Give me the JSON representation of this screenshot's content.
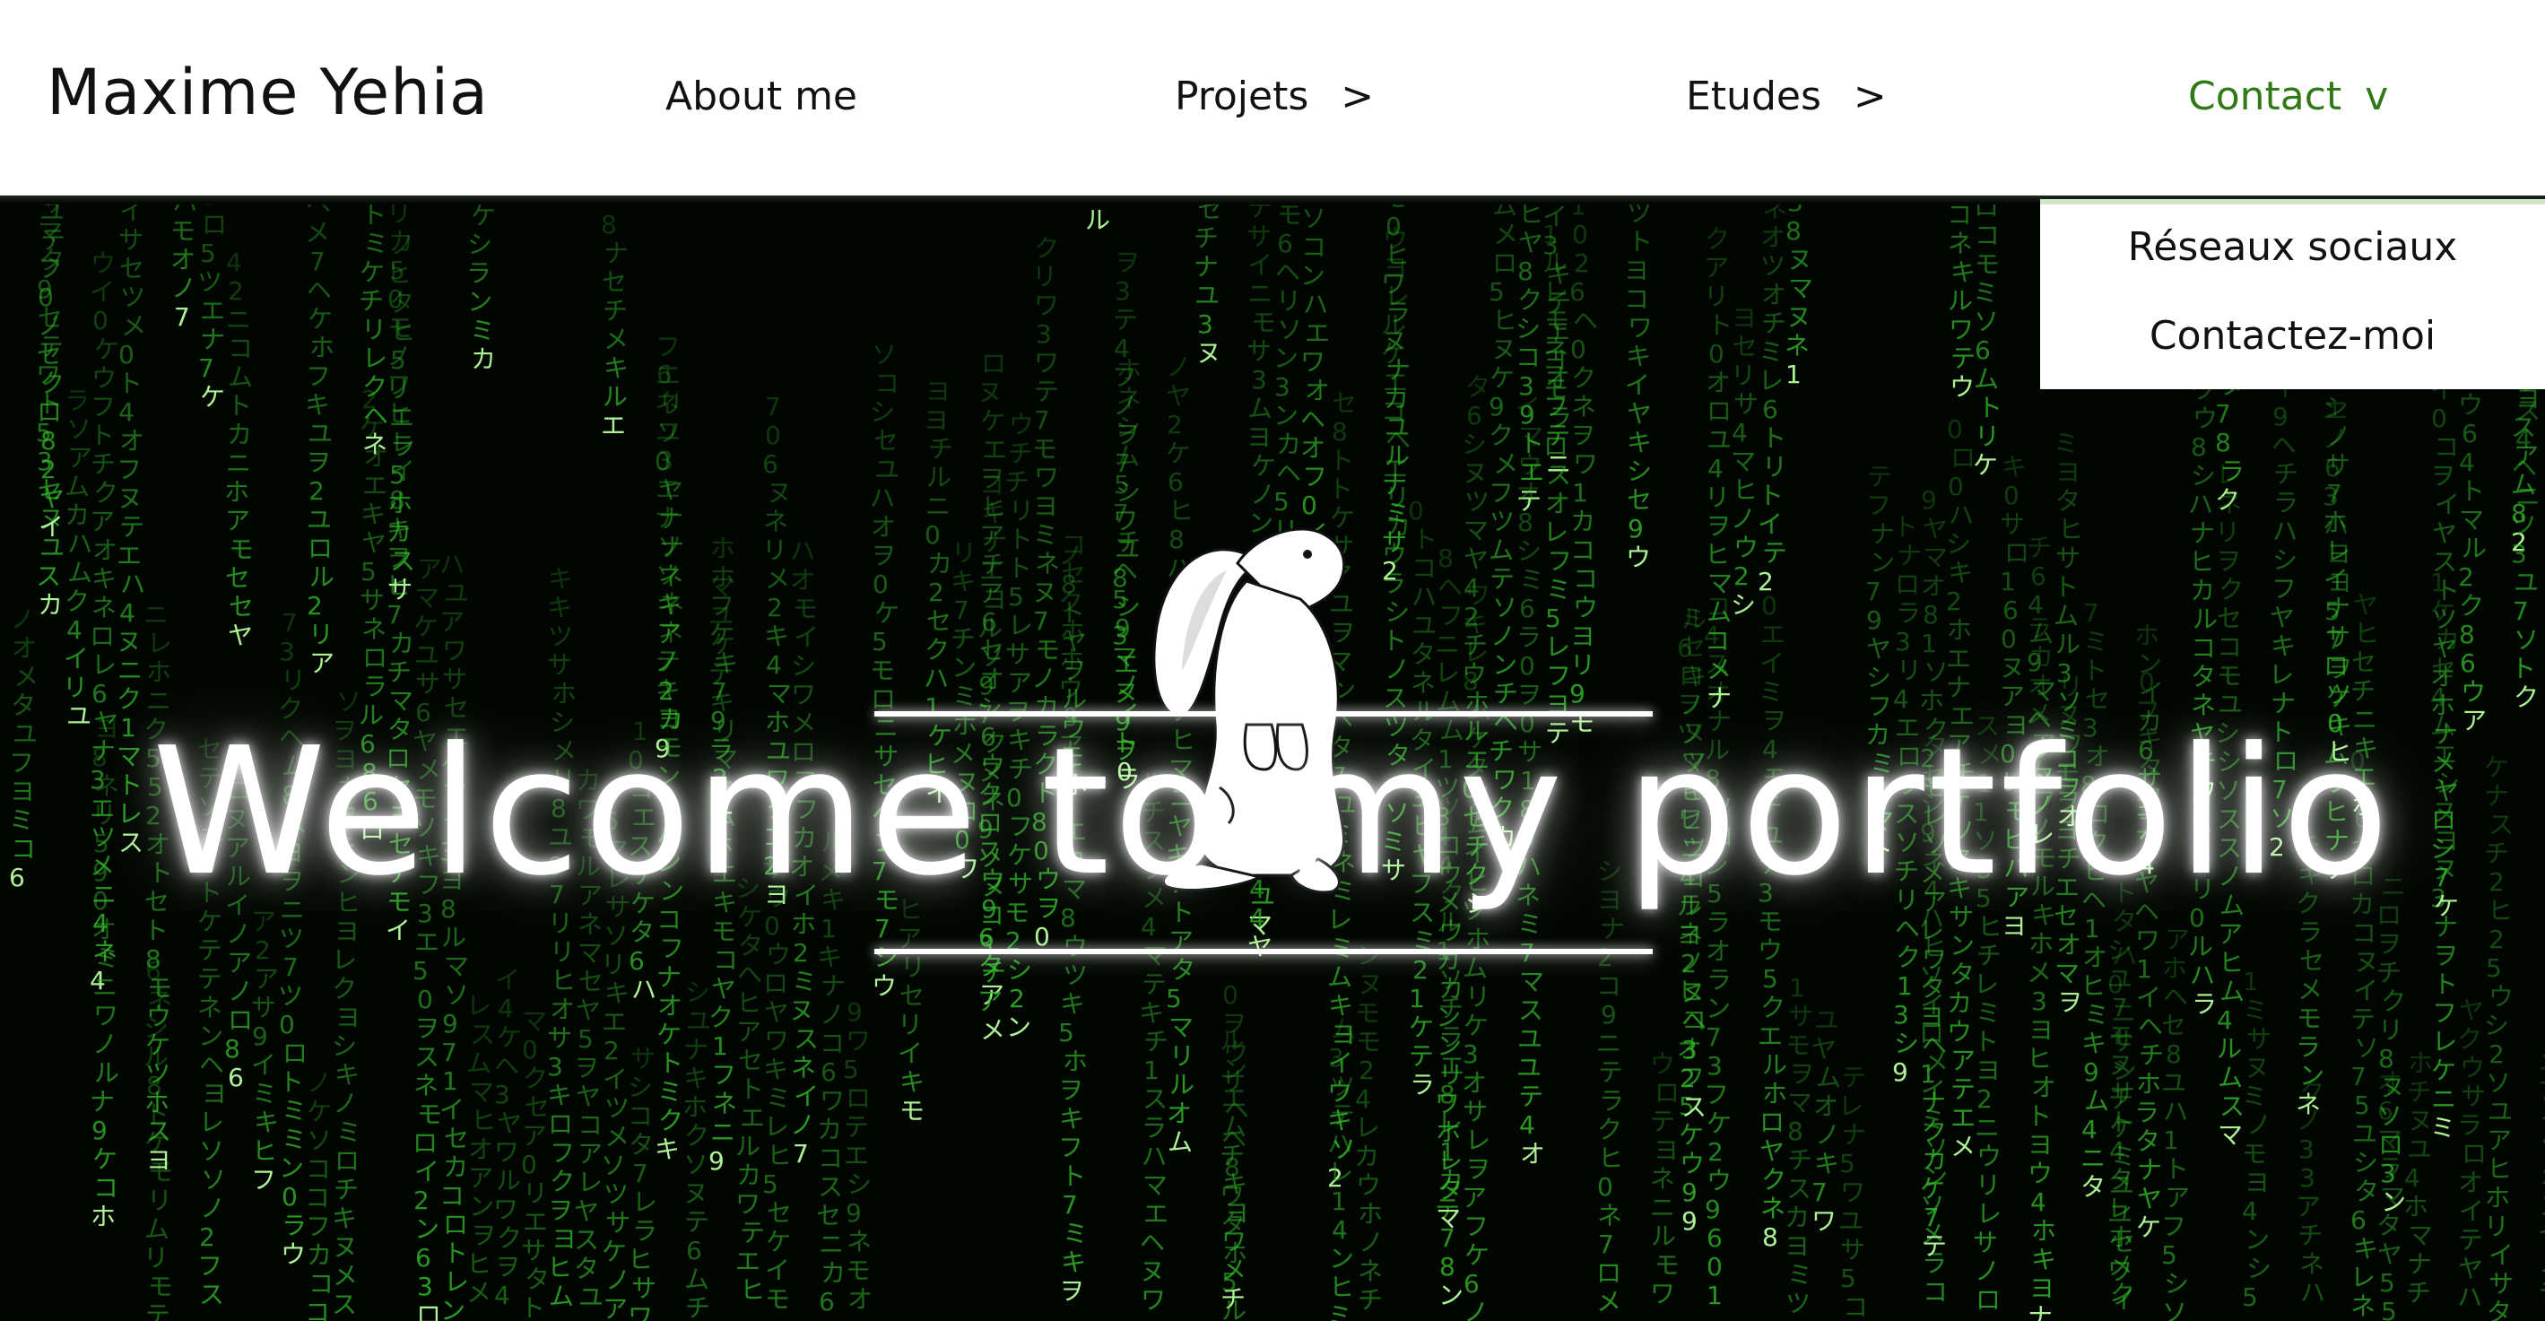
{
  "brand": {
    "name": "Maxime Yehia"
  },
  "nav": {
    "items": [
      {
        "label": "About me",
        "chevron": ""
      },
      {
        "label": "Projets",
        "chevron": ">"
      },
      {
        "label": "Etudes",
        "chevron": ">"
      },
      {
        "label": "Contact",
        "chevron": "v"
      }
    ]
  },
  "dropdown": {
    "items": [
      {
        "label": "Réseaux sociaux"
      },
      {
        "label": "Contactez-moi"
      }
    ]
  },
  "hero": {
    "title": "Welcome to my portfolio"
  },
  "colors": {
    "accent": "#2f7a16",
    "matrix_green": "#34c02b",
    "background": "#000000",
    "navbar": "#ffffff"
  },
  "icons": {
    "hero_image": "rabbit-icon"
  }
}
